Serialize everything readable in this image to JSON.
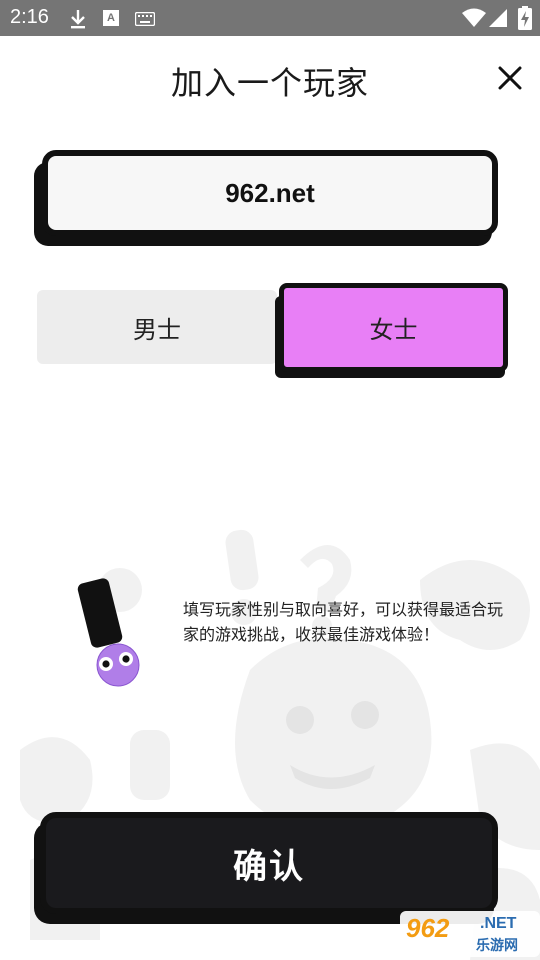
{
  "status_bar": {
    "time": "2:16",
    "icons": [
      "download-icon",
      "font-a-icon",
      "keyboard-icon",
      "wifi-icon",
      "signal-icon",
      "battery-icon"
    ]
  },
  "header": {
    "title": "加入一个玩家",
    "close_icon": "close-icon"
  },
  "form": {
    "name_value": "962.net",
    "gender_options": [
      "男士",
      "女士"
    ],
    "selected_gender": "女士"
  },
  "hint": {
    "text": "填写玩家性别与取向喜好，可以获得最适合玩家的游戏挑战，收获最佳游戏体验！"
  },
  "actions": {
    "confirm_label": "确认"
  },
  "watermark": {
    "logo": "962",
    "net": ".NET",
    "sub": "乐游网"
  },
  "colors": {
    "status_bar": "#757575",
    "accent_pink": "#e87ff6",
    "dark": "#1a1a1d",
    "unselected": "#ededed"
  }
}
